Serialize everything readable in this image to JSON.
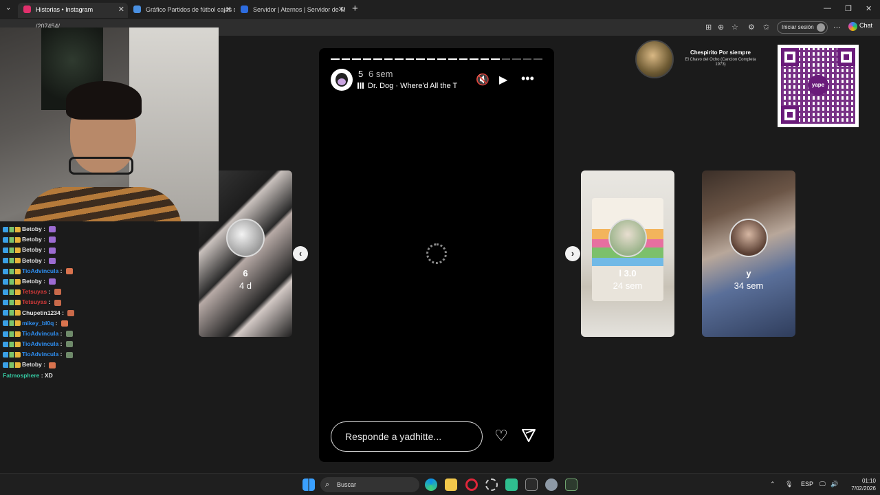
{
  "browser": {
    "tabs": [
      {
        "title": "Historias • Instagram",
        "active": true,
        "favicon_color": "#e1306c"
      },
      {
        "title": "Gráfico Partidos de fútbol cajas de",
        "active": false,
        "favicon_color": "#4a90e2"
      },
      {
        "title": "Servidor | Aternos | Servidor de M",
        "active": false,
        "favicon_color": "#2d6cdf"
      }
    ],
    "new_tab": "+",
    "url": "/207454/",
    "signin_label": "Iniciar sesión",
    "chat_label": "Chat"
  },
  "chat": {
    "messages": [
      {
        "user": "Betoby",
        "message": "",
        "color": "#e6e6e6",
        "emote": "#9c6bd1"
      },
      {
        "user": "Betoby",
        "message": "",
        "color": "#e6e6e6",
        "emote": "#9c6bd1"
      },
      {
        "user": "Betoby",
        "message": "",
        "color": "#e6e6e6",
        "emote": "#9c6bd1"
      },
      {
        "user": "Betoby",
        "message": "",
        "color": "#e6e6e6",
        "emote": "#9c6bd1"
      },
      {
        "user": "TioAdvincula",
        "message": "",
        "color": "#2e8ef0",
        "emote": "#d9734e"
      },
      {
        "user": "Betoby",
        "message": "",
        "color": "#e6e6e6",
        "emote": "#9c6bd1"
      },
      {
        "user": "Tetsuyas",
        "message": "",
        "color": "#d63a3a",
        "emote": "#c96a4a"
      },
      {
        "user": "Tetsuyas",
        "message": "",
        "color": "#d63a3a",
        "emote": "#c96a4a"
      },
      {
        "user": "Chupetin1234",
        "message": "",
        "color": "#e6e6e6",
        "emote": "#c96a4a"
      },
      {
        "user": "mikey_bl0q",
        "message": "",
        "color": "#2e8ef0",
        "emote": "#d9734e"
      },
      {
        "user": "TioAdvincula",
        "message": "",
        "color": "#2e8ef0",
        "emote": "#6f8a6a"
      },
      {
        "user": "TioAdvincula",
        "message": "",
        "color": "#2e8ef0",
        "emote": "#6f8a6a"
      },
      {
        "user": "TioAdvincula",
        "message": "",
        "color": "#2e8ef0",
        "emote": "#6f8a6a"
      },
      {
        "user": "Betoby",
        "message": "",
        "color": "#e6e6e6",
        "emote": "#d9734e"
      },
      {
        "user": "Fatmosphere",
        "message": "XD",
        "color": "#35c7a0",
        "emote": ""
      }
    ]
  },
  "stories_left": [
    {
      "name": "6",
      "time": "4 d"
    }
  ],
  "stories_right": [
    {
      "name": "l 3.0",
      "time": "24 sem"
    },
    {
      "name": "y",
      "time": "34 sem"
    }
  ],
  "story": {
    "user": "5",
    "time": "6 sem",
    "music": "Dr. Dog · Where'd All the T",
    "segments_total": 20,
    "segments_viewed": 16,
    "reply_placeholder": "Responde a yadhitte...",
    "icons": {
      "mute": "muted-speaker-icon",
      "play": "play-icon",
      "more": "more-icon",
      "like": "heart-icon",
      "share": "send-icon"
    }
  },
  "now_playing": {
    "title": "Chespirito Por siempre",
    "subtitle": "El Chavo del Ocho (Cancion Completa 1973)"
  },
  "qr": {
    "label": "yape"
  },
  "taskbar": {
    "search_label": "Buscar",
    "language": "ESP",
    "time": "01:10",
    "date": "7/02/2026"
  }
}
